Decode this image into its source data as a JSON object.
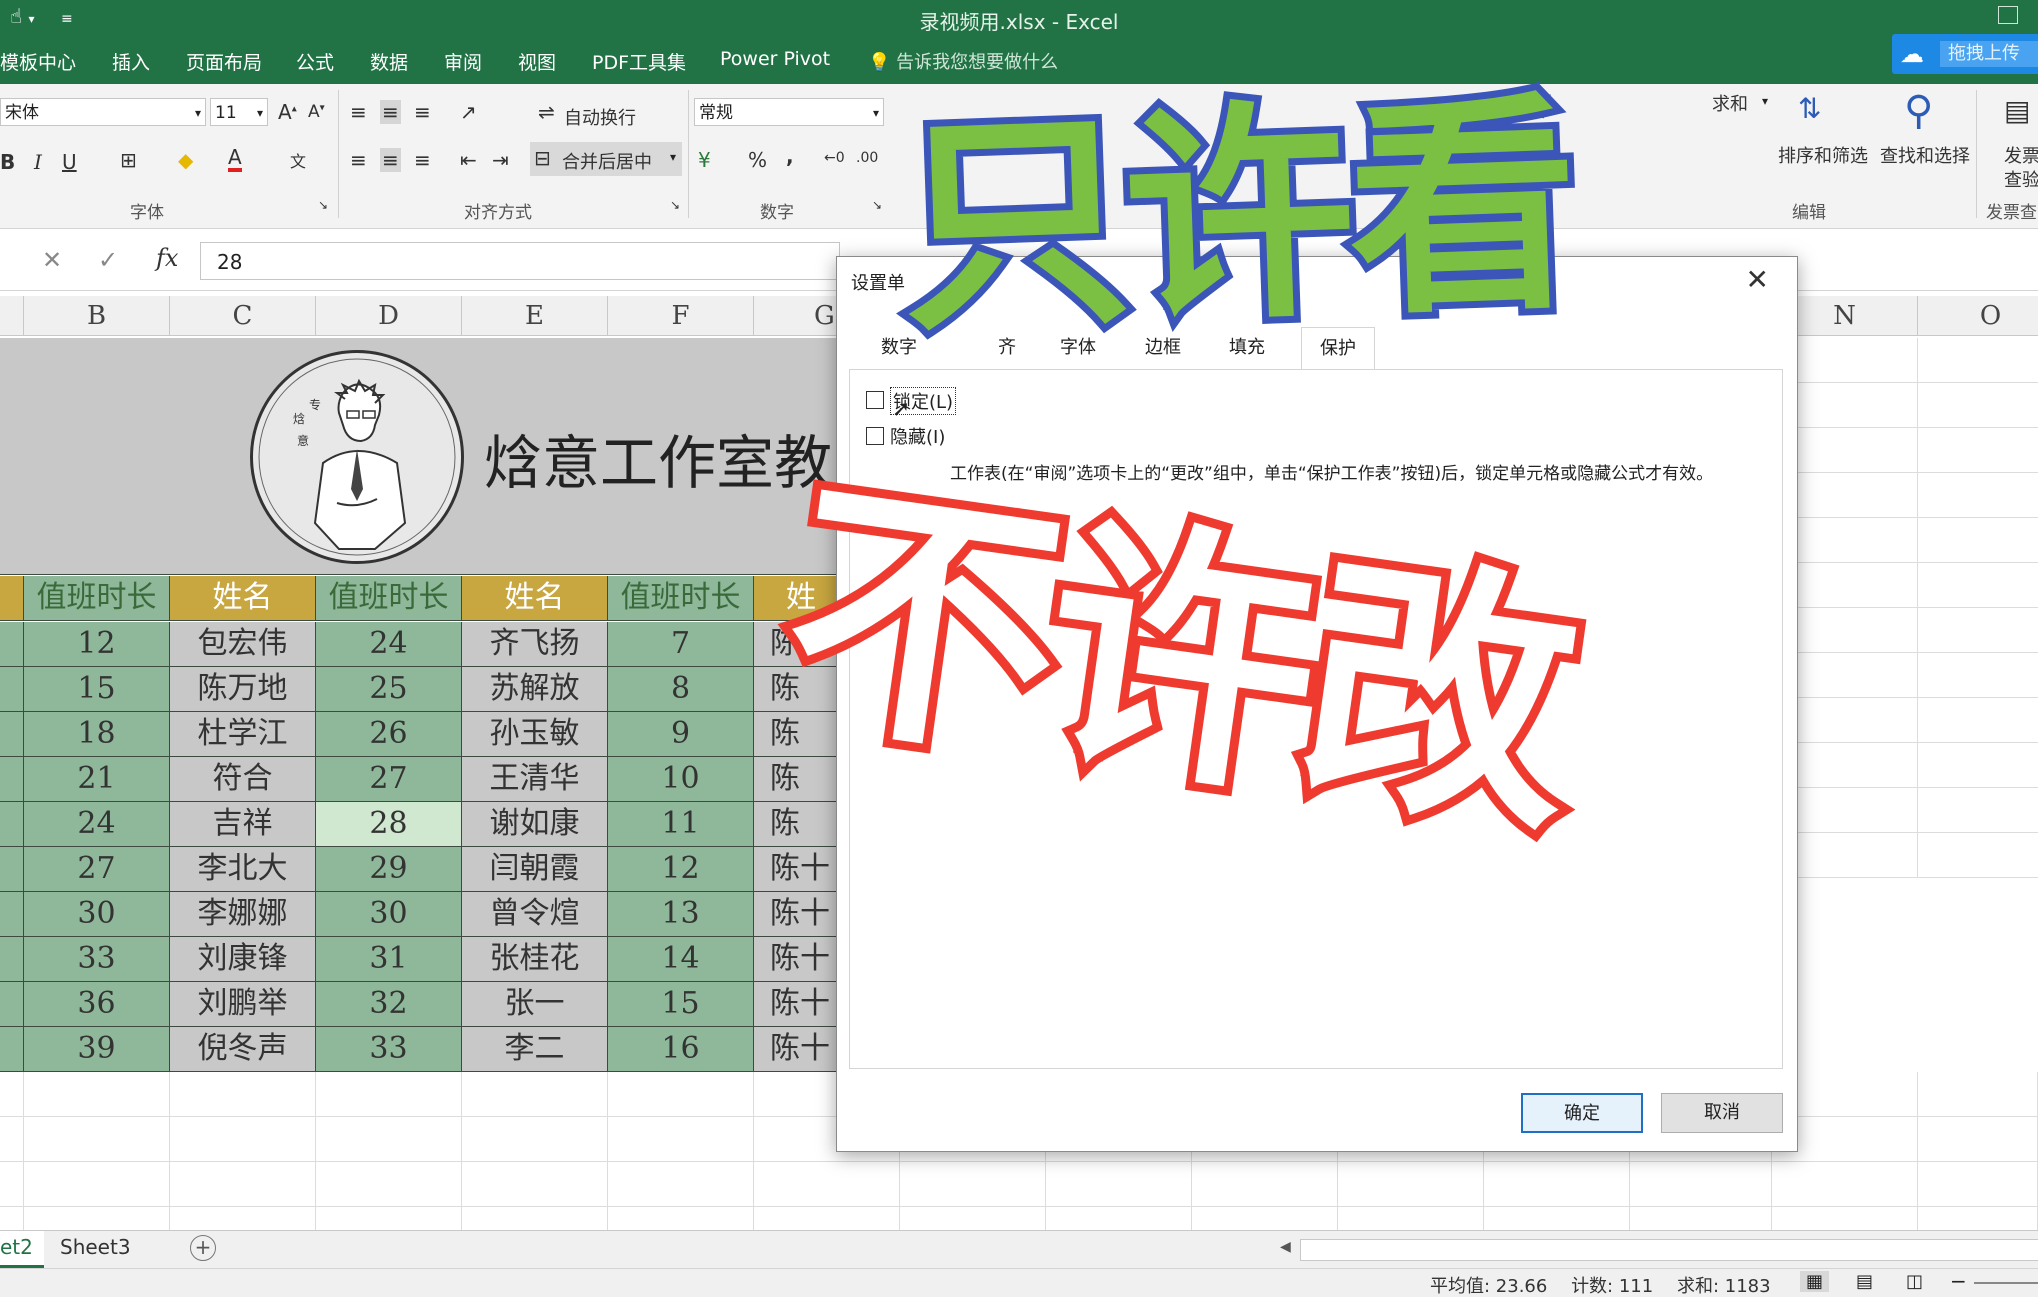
{
  "window": {
    "title": "录视频用.xlsx - Excel"
  },
  "menu": [
    "模板中心",
    "插入",
    "页面布局",
    "公式",
    "数据",
    "审阅",
    "视图",
    "PDF工具集",
    "Power Pivot"
  ],
  "tellme": "告诉我您想要做什么",
  "cloud_upload": "拖拽上传",
  "ribbon": {
    "font_name": "宋体",
    "font_size": "11",
    "wrap_text": "自动换行",
    "merge_center": "合并后居中",
    "number_format": "常规",
    "percent": "%",
    "comma": ",",
    "autosum": "求和",
    "sort_filter": "排序和筛选",
    "find_select": "查找和选择",
    "invoice": "发票",
    "invoice_check": "查验",
    "group_font": "字体",
    "group_align": "对齐方式",
    "group_number": "数字",
    "group_edit": "编辑",
    "group_invoice": "发票查"
  },
  "formula_bar": {
    "value": "28"
  },
  "columns": [
    "B",
    "C",
    "D",
    "E",
    "F",
    "G",
    "N",
    "O"
  ],
  "banner": {
    "text": "焓意工作室教"
  },
  "table": {
    "headers": [
      "值班时长",
      "姓名",
      "值班时长",
      "姓名",
      "值班时长",
      "姓"
    ],
    "rows": [
      [
        "12",
        "包宏伟",
        "24",
        "齐飞扬",
        "7",
        "陈"
      ],
      [
        "15",
        "陈万地",
        "25",
        "苏解放",
        "8",
        "陈"
      ],
      [
        "18",
        "杜学江",
        "26",
        "孙玉敏",
        "9",
        "陈"
      ],
      [
        "21",
        "符合",
        "27",
        "王清华",
        "10",
        "陈"
      ],
      [
        "24",
        "吉祥",
        "28",
        "谢如康",
        "11",
        "陈"
      ],
      [
        "27",
        "李北大",
        "29",
        "闫朝霞",
        "12",
        "陈十"
      ],
      [
        "30",
        "李娜娜",
        "30",
        "曾令煊",
        "13",
        "陈十"
      ],
      [
        "33",
        "刘康锋",
        "31",
        "张桂花",
        "14",
        "陈十"
      ],
      [
        "36",
        "刘鹏举",
        "32",
        "张一",
        "15",
        "陈十"
      ],
      [
        "39",
        "倪冬声",
        "33",
        "李二",
        "16",
        "陈十"
      ]
    ]
  },
  "dialog": {
    "title": "设置单",
    "tabs": [
      "数字",
      "齐",
      "字体",
      "边框",
      "填充",
      "保护"
    ],
    "lock_label": "锁定(L)",
    "hidden_label": "隐藏(I)",
    "note": "工作表(在“审阅”选项卡上的“更改”组中，单击“保护工作表”按钮)后，锁定单元格或隐藏公式才有效。",
    "ok": "确定",
    "cancel": "取消"
  },
  "sheet_tabs": [
    "et2",
    "Sheet3"
  ],
  "status": {
    "average": "平均值: 23.66",
    "count": "计数: 111",
    "sum": "求和: 1183"
  },
  "overlay": {
    "top": "只许看",
    "bottom": "不许改"
  },
  "colors": {
    "excel_green": "#217346",
    "header_gold": "#c8a640",
    "cell_green": "#8fb89a",
    "selected_cell": "#cfe8cf",
    "overlay_green": "#7cc043",
    "overlay_blue": "#3b56b8",
    "overlay_red": "#ef3b2f"
  }
}
